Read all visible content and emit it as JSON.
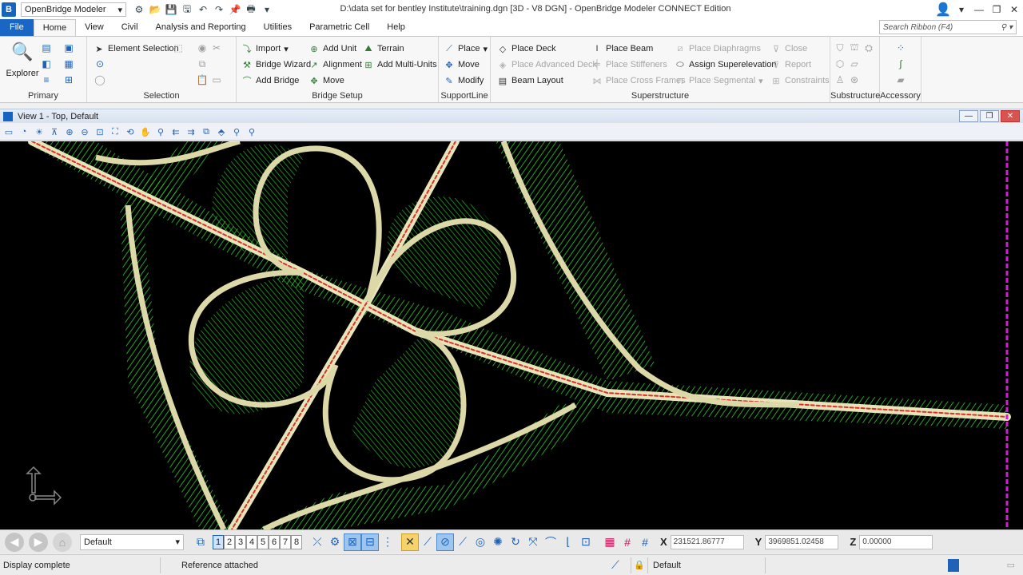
{
  "titlebar": {
    "workflow": "OpenBridge Modeler",
    "window_title": "D:\\data set for bentley Institute\\training.dgn [3D - V8 DGN] - OpenBridge Modeler CONNECT Edition"
  },
  "tabs": [
    "File",
    "Home",
    "View",
    "Civil",
    "Analysis and Reporting",
    "Utilities",
    "Parametric Cell",
    "Help"
  ],
  "active_tab": "Home",
  "ribbon_search_placeholder": "Search Ribbon (F4)",
  "groups": {
    "primary": {
      "label": "Primary",
      "explorer": "Explorer"
    },
    "selection": {
      "label": "Selection",
      "element_selection": "Element Selection"
    },
    "bridge_setup": {
      "label": "Bridge Setup",
      "import": "Import",
      "bridge_wizard": "Bridge Wizard",
      "add_bridge": "Add Bridge",
      "add_unit": "Add Unit",
      "alignment": "Alignment",
      "move": "Move",
      "terrain": "Terrain",
      "add_multi_units": "Add Multi-Units"
    },
    "supportline": {
      "label": "SupportLine",
      "place": "Place",
      "move": "Move",
      "modify": "Modify"
    },
    "superstructure": {
      "label": "Superstructure",
      "place_deck": "Place Deck",
      "place_advanced_deck": "Place Advanced Deck",
      "beam_layout": "Beam Layout",
      "place_beam": "Place Beam",
      "place_stiffeners": "Place Stiffeners",
      "place_cross_frames": "Place Cross Frames",
      "place_diaphragms": "Place Diaphragms",
      "assign_superelevation": "Assign Superelevation",
      "place_segmental": "Place Segmental",
      "close": "Close",
      "report": "Report",
      "constraints": "Constraints"
    },
    "substructure": {
      "label": "Substructure"
    },
    "accessory": {
      "label": "Accessory"
    }
  },
  "view": {
    "title": "View 1 - Top, Default"
  },
  "bottom": {
    "model": "Default",
    "view_numbers": [
      "1",
      "2",
      "3",
      "4",
      "5",
      "6",
      "7",
      "8"
    ],
    "x_label": "X",
    "x": "231521.86777",
    "y_label": "Y",
    "y": "3969851.02458",
    "z_label": "Z",
    "z": "0.00000"
  },
  "status": {
    "message": "Display complete",
    "reference": "Reference attached",
    "level": "Default"
  },
  "colors": {
    "accent": "#1a66c4",
    "terrain_green": "#2fbf2f",
    "road": "#e8e4b8",
    "centerline_red": "#d83030"
  }
}
